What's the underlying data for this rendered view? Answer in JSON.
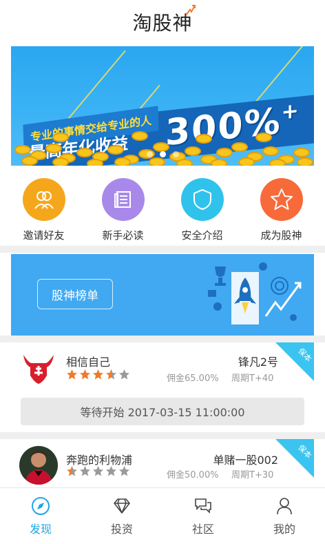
{
  "header": {
    "title": "淘股神"
  },
  "banner": {
    "line1": "专业的事情交给专业的人",
    "line2": "最高年化收益",
    "big": "300%",
    "plus": "+",
    "pages": 3,
    "active_page": 2
  },
  "shortcuts": [
    {
      "label": "邀请好友",
      "icon": "friends-icon",
      "color": "#f5a71c"
    },
    {
      "label": "新手必读",
      "icon": "book-icon",
      "color": "#a889ea"
    },
    {
      "label": "安全介绍",
      "icon": "shield-icon",
      "color": "#2fc3ec"
    },
    {
      "label": "成为股神",
      "icon": "star-icon",
      "color": "#f86a3a"
    }
  ],
  "rank": {
    "button": "股神榜单"
  },
  "cards": [
    {
      "name": "相信自己",
      "product": "锋凡2号",
      "rating": 3.5,
      "fee": "佣金65.00%",
      "period": "周期T+40",
      "badge": "保本"
    },
    {
      "name": "奔跑的利物浦",
      "product": "单赌一股002",
      "rating": 0.5,
      "fee": "佣金50.00%",
      "period": "周期T+30",
      "badge": "保本"
    }
  ],
  "wait": {
    "text": "等待开始 2017-03-15 11:00:00"
  },
  "tabs": [
    {
      "label": "发现",
      "icon": "compass-icon",
      "active": true
    },
    {
      "label": "投资",
      "icon": "diamond-icon",
      "active": false
    },
    {
      "label": "社区",
      "icon": "chat-icon",
      "active": false
    },
    {
      "label": "我的",
      "icon": "user-icon",
      "active": false
    }
  ],
  "colors": {
    "accent": "#1ca7e4",
    "star": "#f07b2c",
    "badge": "#3cc4f0"
  }
}
